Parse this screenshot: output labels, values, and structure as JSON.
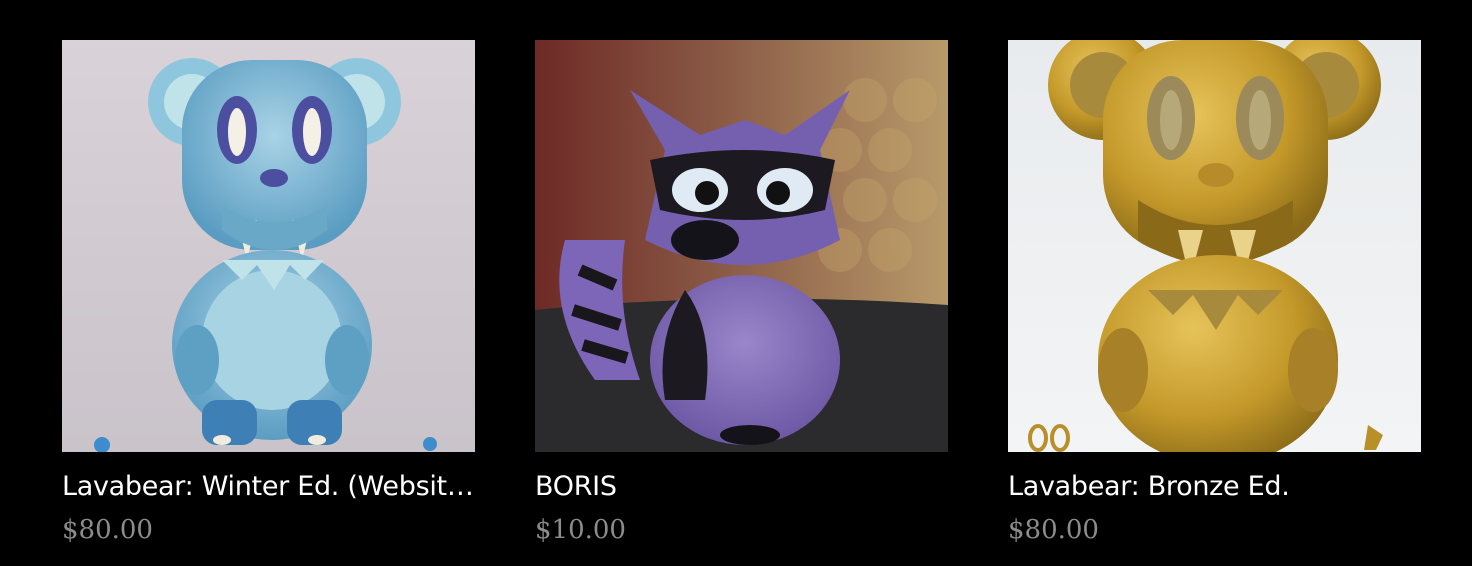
{
  "products": [
    {
      "title": "Lavabear: Winter Ed. (Website …",
      "price": "$80.00",
      "image_desc": "blue-lavabear-figure-image"
    },
    {
      "title": "BORIS",
      "price": "$10.00",
      "image_desc": "purple-raccoon-figure-image"
    },
    {
      "title": "Lavabear: Bronze Ed.",
      "price": "$80.00",
      "image_desc": "gold-lavabear-figure-image"
    }
  ],
  "colors": {
    "background": "#000000",
    "title": "#ffffff",
    "price": "#8c8c8c"
  }
}
